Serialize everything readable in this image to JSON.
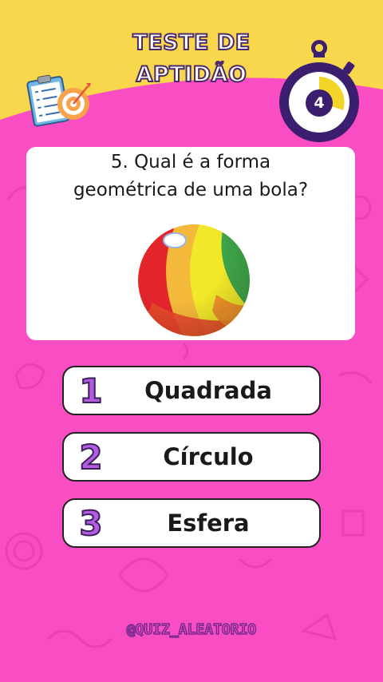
{
  "header": {
    "title_line1": "TESTE DE",
    "title_line2": "APTIDÃO"
  },
  "timer": {
    "value": "4"
  },
  "question": {
    "text": "5. Qual é a forma geométrica de uma bola?",
    "image_icon": "beach-ball-icon"
  },
  "options": [
    {
      "number": "1",
      "label": "Quadrada"
    },
    {
      "number": "2",
      "label": "Círculo"
    },
    {
      "number": "3",
      "label": "Esfera"
    }
  ],
  "footer": {
    "handle": "@QUIZ_ALEATORIO"
  },
  "colors": {
    "top_background": "#F9D74C",
    "main_background": "#F94EC3",
    "timer_ring": "#3B1E6E",
    "timer_progress": "#F3D428",
    "option_number": "#B25BE0"
  }
}
